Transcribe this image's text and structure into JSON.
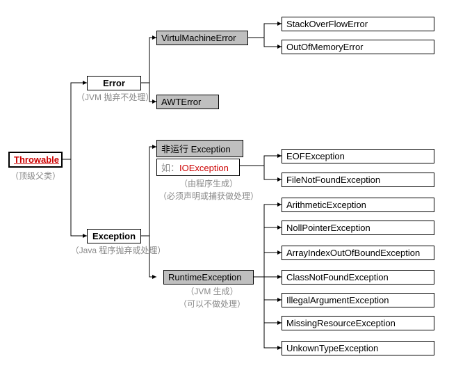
{
  "root": {
    "label": "Throwable",
    "caption": "（顶级父类）"
  },
  "error": {
    "label": "Error",
    "caption": "（JVM 抛弃不处理）",
    "children": {
      "vme": {
        "label": "VirtulMachineError",
        "children": [
          "StackOverFlowError",
          "OutOfMemoryError"
        ]
      },
      "awt": {
        "label": "AWTError"
      }
    }
  },
  "exception": {
    "label": "Exception",
    "caption": "（Java 程序抛弃或处理）",
    "checked": {
      "label": "非运行 Exception",
      "example_prefix": "如：",
      "example_name": "IOException",
      "caption1": "（由程序生成）",
      "caption2": "（必须声明或捕获做处理）",
      "children": [
        "EOFException",
        "FileNotFoundException"
      ]
    },
    "runtime": {
      "label": "RuntimeException",
      "caption1": "（JVM 生成）",
      "caption2": "（可以不做处理）",
      "children": [
        "ArithmeticException",
        "NollPointerException",
        "ArrayIndexOutOfBoundException",
        "ClassNotFoundException",
        "IllegalArgumentException",
        "MissingResourceException",
        "UnkownTypeException"
      ]
    }
  },
  "chart_data": {
    "type": "tree",
    "title": "",
    "root": {
      "name": "Throwable",
      "note": "顶级父类",
      "children": [
        {
          "name": "Error",
          "note": "JVM 抛弃不处理",
          "children": [
            {
              "name": "VirtulMachineError",
              "children": [
                {
                  "name": "StackOverFlowError"
                },
                {
                  "name": "OutOfMemoryError"
                }
              ]
            },
            {
              "name": "AWTError"
            }
          ]
        },
        {
          "name": "Exception",
          "note": "Java 程序抛弃或处理",
          "children": [
            {
              "name": "非运行 Exception",
              "note": "由程序生成；必须声明或捕获做处理",
              "example": "IOException",
              "children": [
                {
                  "name": "EOFException"
                },
                {
                  "name": "FileNotFoundException"
                }
              ]
            },
            {
              "name": "RuntimeException",
              "note": "JVM 生成；可以不做处理",
              "children": [
                {
                  "name": "ArithmeticException"
                },
                {
                  "name": "NollPointerException"
                },
                {
                  "name": "ArrayIndexOutOfBoundException"
                },
                {
                  "name": "ClassNotFoundException"
                },
                {
                  "name": "IllegalArgumentException"
                },
                {
                  "name": "MissingResourceException"
                },
                {
                  "name": "UnkownTypeException"
                }
              ]
            }
          ]
        }
      ]
    }
  }
}
